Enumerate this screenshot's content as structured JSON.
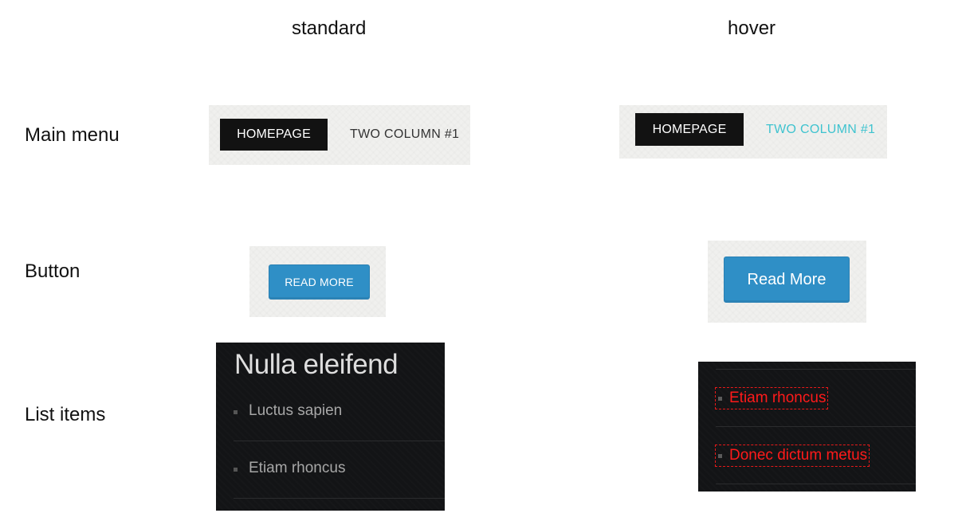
{
  "columns": {
    "standard": "standard",
    "hover": "hover"
  },
  "rows": {
    "main_menu": "Main menu",
    "button": "Button",
    "list_items": "List items"
  },
  "menu": {
    "active_label": "HOMEPAGE",
    "item_label": "TWO COLUMN #1",
    "hover_color": "#3fc3cf"
  },
  "button": {
    "standard_label": "READ MORE",
    "hover_label": "Read More",
    "color": "#2f8fc6"
  },
  "list": {
    "title": "Nulla eleifend",
    "standard_items": [
      "Luctus sapien",
      "Etiam rhoncus"
    ],
    "hover_items": [
      "Etiam rhoncus",
      "Donec dictum metus"
    ],
    "hover_text_color": "#ff1a1a"
  }
}
